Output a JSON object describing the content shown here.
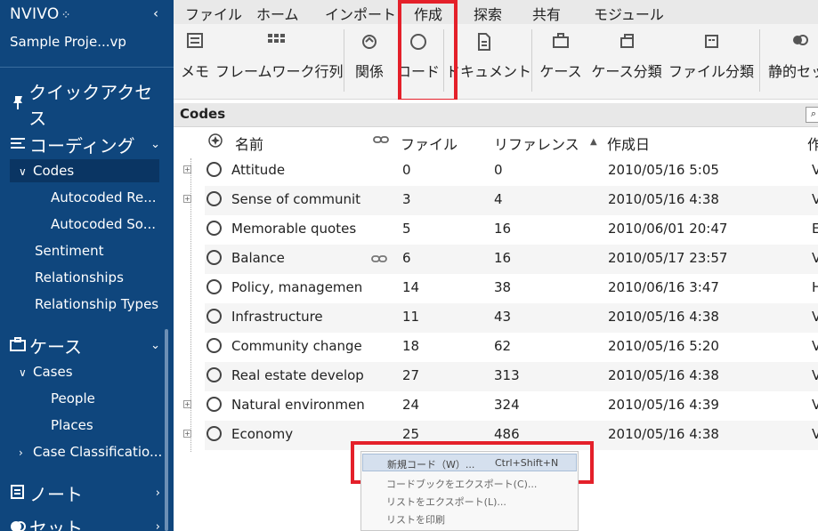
{
  "sidebar": {
    "brand": "NVIVO",
    "brand_dots": "⁘",
    "collapse_icon": "‹",
    "project": "Sample Proje...vp",
    "quick_access": "クイックアクセス",
    "coding": {
      "label": "コーディング",
      "items": [
        {
          "label": "Codes"
        },
        {
          "label": "Autocoded Re..."
        },
        {
          "label": "Autocoded So..."
        },
        {
          "label": "Sentiment"
        },
        {
          "label": "Relationships"
        },
        {
          "label": "Relationship Types"
        }
      ]
    },
    "cases": {
      "label": "ケース",
      "items": [
        {
          "label": "Cases"
        },
        {
          "label": "People"
        },
        {
          "label": "Places"
        },
        {
          "label": "Case Classificatio..."
        }
      ]
    },
    "notes": {
      "label": "ノート"
    },
    "sets": {
      "label": "セット"
    }
  },
  "ribbon": {
    "tabs": [
      {
        "label": "ファイル"
      },
      {
        "label": "ホーム"
      },
      {
        "label": "インポート"
      },
      {
        "label": "作成"
      },
      {
        "label": "探索"
      },
      {
        "label": "共有"
      },
      {
        "label": "モジュール"
      }
    ],
    "buttons": [
      {
        "label": "メモ",
        "icon": "memo-icon"
      },
      {
        "label": "フレームワーク行列",
        "icon": "grid-icon"
      },
      {
        "label": "関係",
        "icon": "relationship-icon"
      },
      {
        "label": "コード",
        "icon": "code-circle-icon"
      },
      {
        "label": "ドキュメント",
        "icon": "document-icon"
      },
      {
        "label": "ケース",
        "icon": "case-icon"
      },
      {
        "label": "ケース分類",
        "icon": "case-classification-icon"
      },
      {
        "label": "ファイル分類",
        "icon": "file-classification-icon"
      },
      {
        "label": "静的セッ",
        "icon": "static-set-icon"
      }
    ]
  },
  "codes": {
    "title": "Codes",
    "columns": {
      "name": "名前",
      "files": "ファイル",
      "references": "リファレンス",
      "created": "作成日",
      "created_by": "作"
    },
    "rows": [
      {
        "name": "Attitude",
        "files": "0",
        "refs": "0",
        "created": "2010/05/16 5:05",
        "by": "V"
      },
      {
        "name": "Sense of communit",
        "files": "3",
        "refs": "4",
        "created": "2010/05/16 4:38",
        "by": "V"
      },
      {
        "name": "Memorable quotes",
        "files": "5",
        "refs": "16",
        "created": "2010/06/01 20:47",
        "by": "E"
      },
      {
        "name": "Balance",
        "files": "6",
        "refs": "16",
        "created": "2010/05/17 23:57",
        "by": "V"
      },
      {
        "name": "Policy, managemen",
        "files": "14",
        "refs": "38",
        "created": "2010/06/16 3:47",
        "by": "H"
      },
      {
        "name": "Infrastructure",
        "files": "11",
        "refs": "43",
        "created": "2010/05/16 4:38",
        "by": "V"
      },
      {
        "name": "Community change",
        "files": "18",
        "refs": "62",
        "created": "2010/05/16 5:20",
        "by": "V"
      },
      {
        "name": "Real estate develop",
        "files": "27",
        "refs": "313",
        "created": "2010/05/16 4:38",
        "by": "V"
      },
      {
        "name": "Natural environmen",
        "files": "24",
        "refs": "324",
        "created": "2010/05/16 4:39",
        "by": "V"
      },
      {
        "name": "Economy",
        "files": "25",
        "refs": "486",
        "created": "2010/05/16 4:38",
        "by": "V"
      }
    ]
  },
  "context_menu": {
    "items": [
      {
        "label": "新規コード（W）...",
        "shortcut": "Ctrl+Shift+N"
      },
      {
        "label": "コードブックをエクスポート(C)..."
      },
      {
        "label": "リストをエクスポート(L)..."
      },
      {
        "label": "リストを印刷"
      }
    ]
  },
  "colors": {
    "sidebar": "#0f467d",
    "highlight": "#e4202a",
    "menu_selected": "#d5e0ee"
  }
}
